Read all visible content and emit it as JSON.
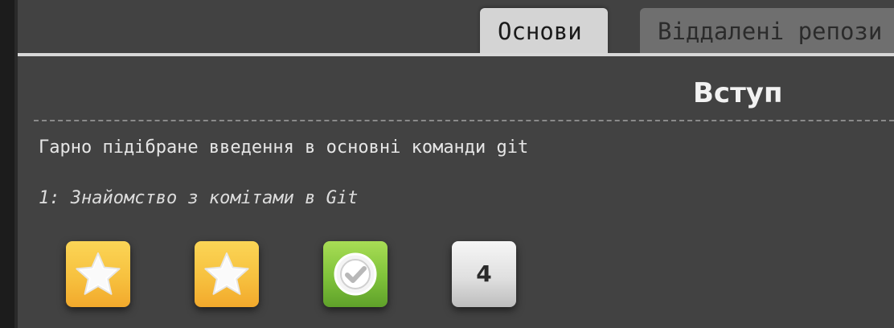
{
  "tabs": [
    {
      "label": "Основи",
      "active": true
    },
    {
      "label": "Віддалені репози",
      "active": false
    }
  ],
  "section": {
    "title": "Вступ",
    "description": "Гарно підібране введення в основні команди git"
  },
  "level": {
    "title": "1: Знайомство з комітами в Git",
    "buttons": [
      {
        "kind": "star",
        "icon": "star-icon"
      },
      {
        "kind": "star",
        "icon": "star-icon"
      },
      {
        "kind": "completed",
        "icon": "checkmark-icon"
      },
      {
        "kind": "number",
        "label": "4"
      }
    ]
  },
  "colors": {
    "background": "#424242",
    "active_tab": "#d4d4d4",
    "inactive_tab": "#6f6f6f",
    "star_badge": "#f7c13f",
    "check_badge": "#7fc23a",
    "number_badge": "#e0e0e0"
  }
}
